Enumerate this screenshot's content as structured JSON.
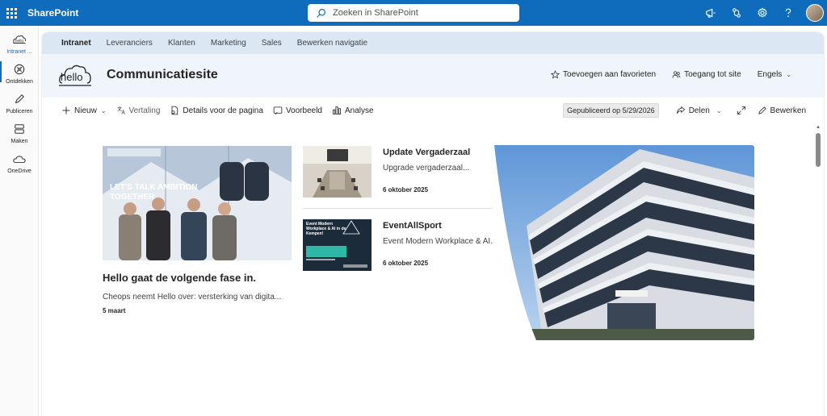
{
  "suite": {
    "app_name": "SharePoint",
    "search_placeholder": "Zoeken in SharePoint"
  },
  "appbar": {
    "items": [
      {
        "label": "Intranet ...",
        "icon": "hello-logo-icon"
      },
      {
        "label": "Ontdekken",
        "icon": "compass-icon"
      },
      {
        "label": "Publiceren",
        "icon": "pen-icon"
      },
      {
        "label": "Maken",
        "icon": "create-icon"
      },
      {
        "label": "OneDrive",
        "icon": "cloud-icon"
      }
    ]
  },
  "hubnav": {
    "items": [
      "Intranet",
      "Leveranciers",
      "Klanten",
      "Marketing",
      "Sales",
      "Bewerken navigatie"
    ]
  },
  "site": {
    "logo_text": "hello",
    "title": "Communicatiesite",
    "favorite": "Toevoegen aan favorieten",
    "access": "Toegang tot site",
    "language": "Engels"
  },
  "commandbar": {
    "new": "Nieuw",
    "translation": "Vertaling",
    "details": "Details voor de pagina",
    "preview": "Voorbeeld",
    "analytics": "Analyse",
    "published": "Gepubliceerd op 5/29/2026",
    "share": "Delen",
    "edit": "Bewerken"
  },
  "news": {
    "main": {
      "title": "Hello gaat de volgende fase in.",
      "description": "Cheops neemt Hello over: versterking van digita...",
      "date": "5 maart",
      "image_text": "LET'S TALK AMBITION TOGETHER"
    },
    "items": [
      {
        "title": "Update Vergaderzaal",
        "description": "Upgrade vergaderzaal...",
        "date": "6 oktober 2025"
      },
      {
        "title": "EventAllSport",
        "description": "Event Modern Workplace & AI...",
        "date": "6 oktober 2025",
        "image_text": "Event Modern Workplace & AI in de Kempen!"
      }
    ]
  },
  "colors": {
    "brand_blue": "#0f6cbd",
    "hubnav_bg": "#dbe7f3",
    "header_bg": "#eff5fb"
  }
}
